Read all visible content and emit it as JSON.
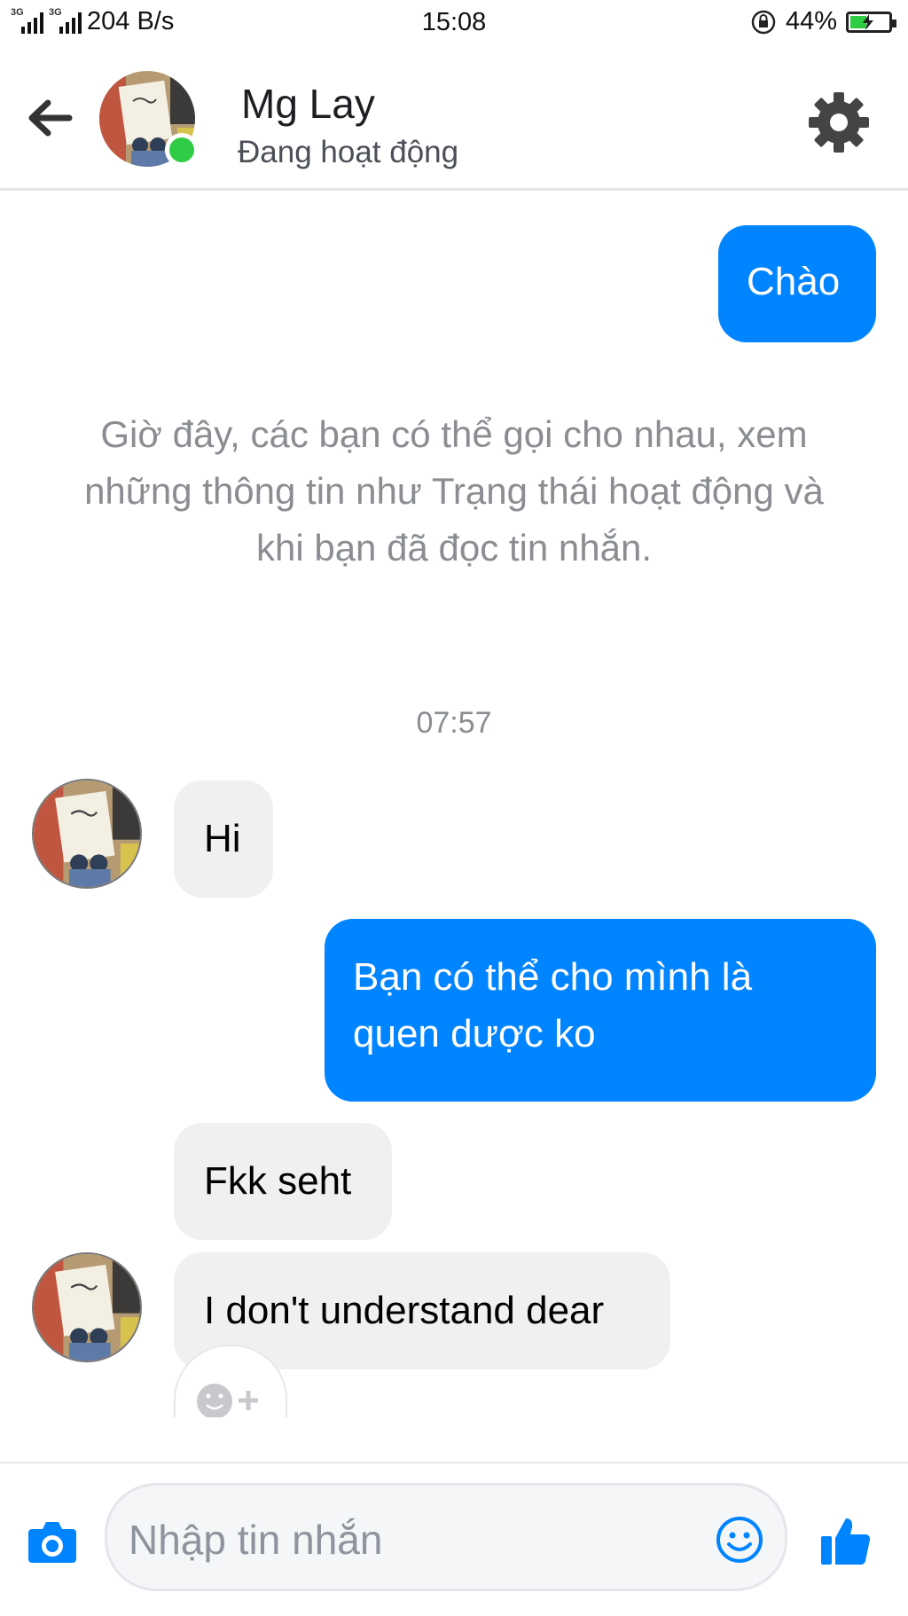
{
  "status_bar": {
    "network_1": "3G",
    "network_2": "3G",
    "speed": "204 B/s",
    "time": "15:08",
    "battery": "44%",
    "battery_level": 0.44
  },
  "header": {
    "contact_name": "Mg Lay",
    "contact_status": "Đang hoạt động",
    "online": true
  },
  "messages": [
    {
      "id": "m1",
      "direction": "outgoing",
      "text": "Chào"
    },
    {
      "id": "m2",
      "direction": "incoming",
      "text": "Hi"
    },
    {
      "id": "m3",
      "direction": "outgoing",
      "lines": [
        "Bạn có thể cho mình là",
        "quen dược ko"
      ]
    },
    {
      "id": "m4",
      "direction": "incoming",
      "text": "Fkk seht"
    },
    {
      "id": "m5",
      "direction": "incoming",
      "text": "I don't understand dear"
    }
  ],
  "system_notice": {
    "lines": [
      "Giờ đây, các bạn có thể gọi cho nhau, xem",
      "những thông tin như Trạng thái hoạt động và",
      "khi bạn đã đọc tin nhắn."
    ]
  },
  "timestamp": "07:57",
  "composer": {
    "placeholder": "Nhập tin nhắn"
  },
  "colors": {
    "outgoing_bubble": "#0084ff",
    "incoming_bubble": "#f1f0f0",
    "online_dot": "#31cc46",
    "accent": "#0084ff"
  },
  "icons": [
    "back-arrow-icon",
    "gear-icon",
    "camera-icon",
    "emoji-icon",
    "like-icon",
    "reaction-add-icon"
  ]
}
